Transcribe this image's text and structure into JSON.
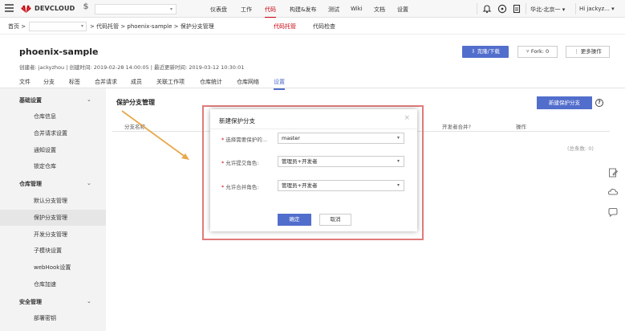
{
  "topbar": {
    "brand": "DEVCLOUD",
    "dollar": "$",
    "nav": [
      "仪表盘",
      "工作",
      "代码",
      "构建&发布",
      "测试",
      "Wiki",
      "文档",
      "设置"
    ],
    "active_nav": "代码",
    "region": "华北-北京一",
    "user": "Hi jackyz...",
    "accent": "#c7000b"
  },
  "subbar": {
    "home": "首页 >",
    "path": "> 代码托管 > phoenix-sample > 保护分支管理",
    "tabs": [
      "代码托管",
      "代码检查"
    ]
  },
  "repo": {
    "name": "phoenix-sample",
    "meta": "创建者: jackyzhou  |  创建时间: 2019-02-28 14:00:05  |  最近更新时间: 2019-03-12 10:30:01",
    "clone_btn": "⇩ 克隆/下载",
    "fork_btn": "Fork: 0",
    "more_btn": "更多操作",
    "tabs": [
      "文件",
      "分支",
      "标签",
      "合并请求",
      "成员",
      "关联工作项",
      "仓库统计",
      "仓库网络",
      "设置"
    ]
  },
  "sidebar": {
    "group1": "基础设置",
    "group1_items": [
      "仓库信息",
      "合并请求设置",
      "通知设置",
      "锁定仓库"
    ],
    "group2": "仓库管理",
    "group2_items": [
      "默认分支管理",
      "保护分支管理",
      "开发分支管理",
      "子模块设置",
      "webHook设置",
      "仓库加速"
    ],
    "group3": "安全管理",
    "group3_items": [
      "部署密钥"
    ]
  },
  "main": {
    "title": "保护分支管理",
    "new_btn": "新建保护分支",
    "col_branch": "分支名称",
    "col_dev_merge": "开发者合并?",
    "col_action": "操作",
    "total": "(总条数: 0)"
  },
  "modal": {
    "title": "新建保护分支",
    "close": "×",
    "field1_label": "选择需要保护的...",
    "field1_value": "master",
    "field2_label": "允许提交角色:",
    "field2_value": "管理员+开发者",
    "field3_label": "允许合并角色:",
    "field3_value": "管理员+开发者",
    "ok": "确定",
    "cancel": "取消"
  },
  "icons": {
    "menu": "menu-icon",
    "notify": "bell-icon",
    "help": "help-icon",
    "doc": "doc-icon"
  },
  "colors": {
    "primary": "#526ecc",
    "highlight_border": "#e07b7b",
    "arrow": "#e8a84c"
  }
}
